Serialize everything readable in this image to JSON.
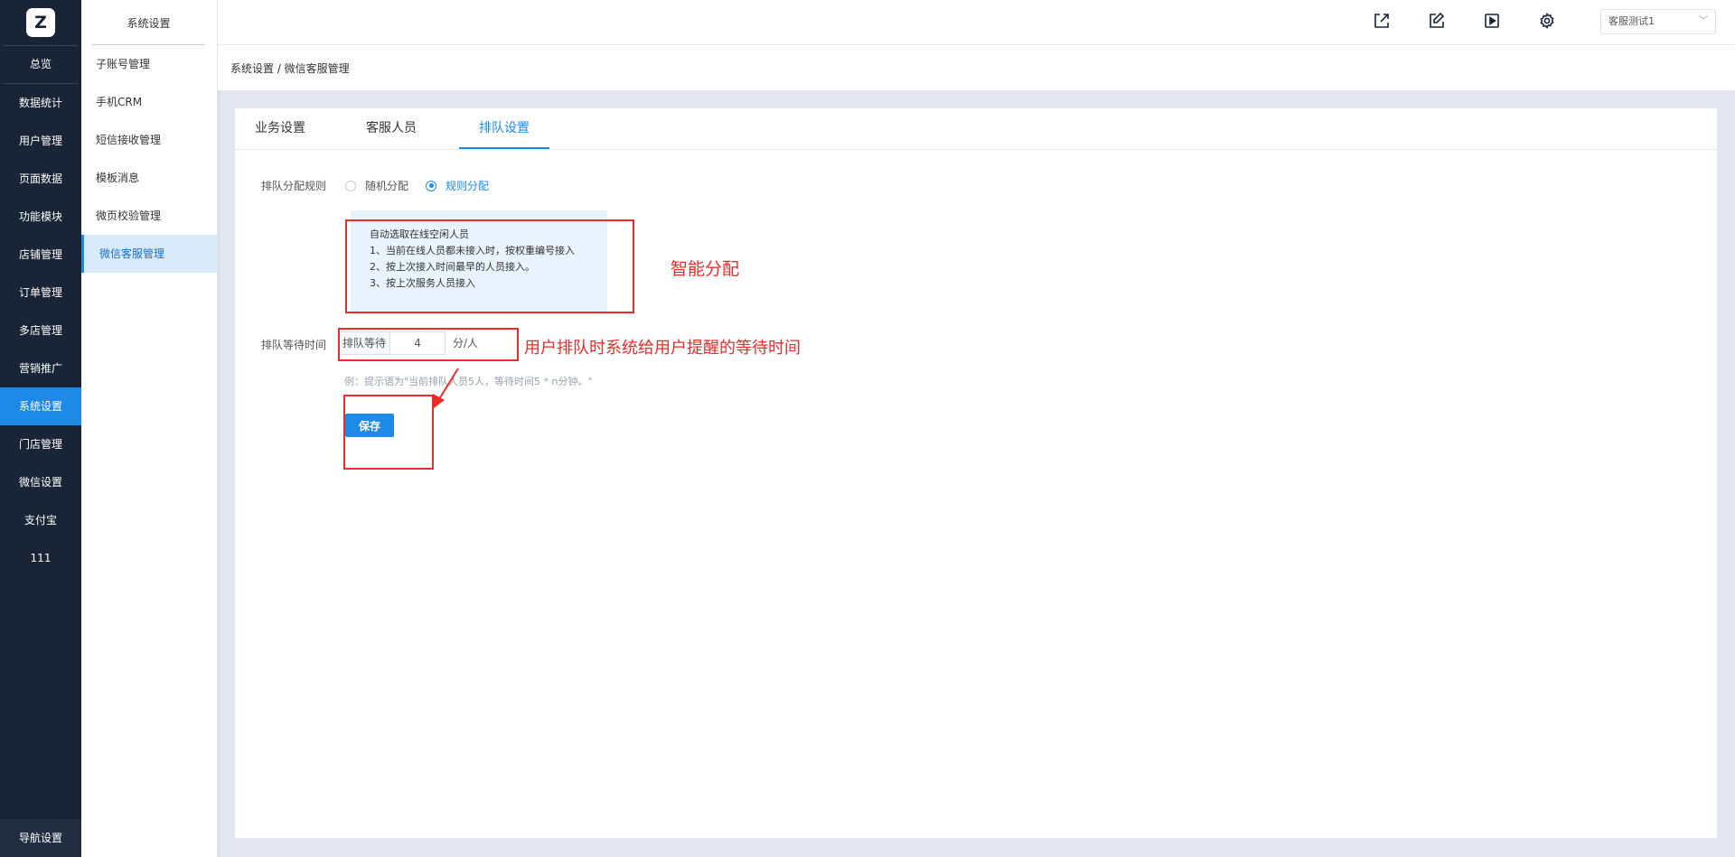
{
  "logo": {
    "letter": "Z"
  },
  "leftnav": {
    "items": [
      "总览",
      "数据统计",
      "用户管理",
      "页面数据",
      "功能模块",
      "店铺管理",
      "订单管理",
      "多店管理",
      "营销推广",
      "系统设置",
      "门店管理",
      "微信设置",
      "支付宝",
      "111"
    ],
    "active": "系统设置",
    "bottom": "导航设置"
  },
  "subnav": {
    "title": "系统设置",
    "items": [
      "子账号管理",
      "手机CRM",
      "短信接收管理",
      "模板消息",
      "微页校验管理",
      "微信客服管理"
    ],
    "active": "微信客服管理"
  },
  "topbar": {
    "icons": [
      "external-link-icon",
      "edit-icon",
      "play-icon",
      "gear-icon"
    ],
    "account": "客服测试1"
  },
  "breadcrumb": "系统设置 / 微信客服管理",
  "tabs": [
    "业务设置",
    "客服人员",
    "排队设置"
  ],
  "active_tab": "排队设置",
  "form": {
    "rule_label": "排队分配规则",
    "options": [
      "随机分配",
      "规则分配"
    ],
    "selected": "规则分配",
    "info_lines": [
      "自动选取在线空闲人员",
      "1、当前在线人员都未接入时，按权重编号接入",
      "2、按上次接入时间最早的人员接入。",
      "3、按上次服务人员接入"
    ],
    "wait_label": "排队等待时间",
    "wait_prefix": "排队等待",
    "wait_value": "4",
    "wait_suffix": "分/人",
    "hint": "例：提示语为\"当前排队人员5人，等待时间5 * n分钟。\"",
    "save": "保存"
  },
  "annotations": {
    "smart": "智能分配",
    "wait_desc": "用户排队时系统给用户提醒的等待时间",
    "color": "#ee2b2b"
  },
  "colors": {
    "accent": "#1e8ae8",
    "nav_bg": "#1a2437"
  }
}
